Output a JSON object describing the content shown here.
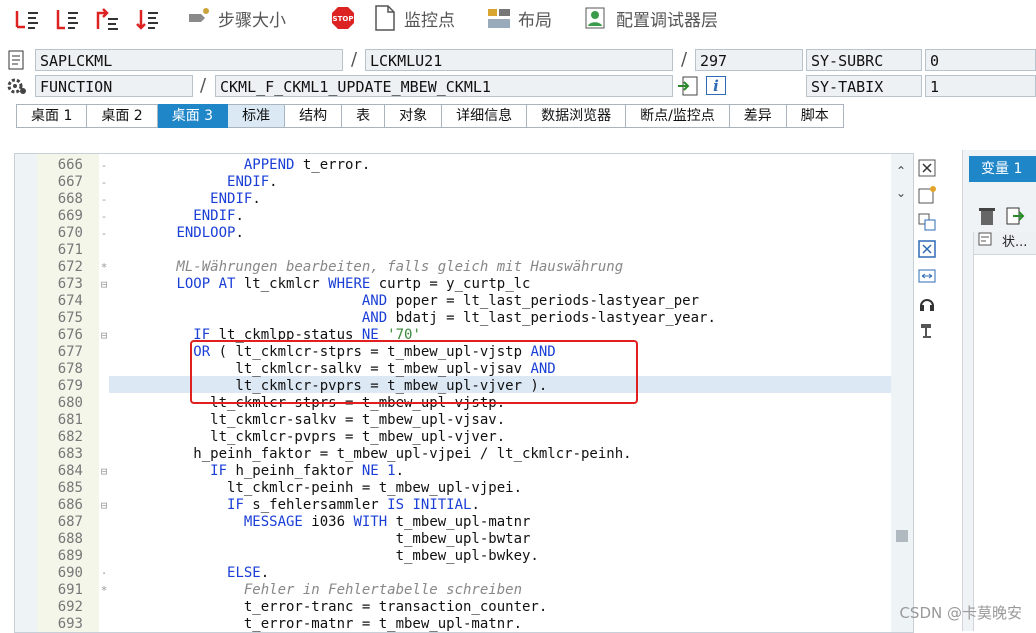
{
  "toolbar": {
    "step_label": "步骤大小",
    "watchpoint_label": "监控点",
    "layout_label": "布局",
    "config_label": "配置调试器层",
    "stop_text": "STOP"
  },
  "header": {
    "program": "SAPLCKML",
    "include": "LCKMLU21",
    "line": "297",
    "sy_subrc_label": "SY-SUBRC",
    "sy_subrc_value": "0",
    "type": "FUNCTION",
    "function_name": "CKML_F_CKML1_UPDATE_MBEW_CKML1",
    "sy_tabix_label": "SY-TABIX",
    "sy_tabix_value": "1",
    "info_text": "i",
    "slash": "/"
  },
  "tabs": [
    "桌面 1",
    "桌面 2",
    "桌面 3",
    "标准",
    "结构",
    "表",
    "对象",
    "详细信息",
    "数据浏览器",
    "断点/监控点",
    "差异",
    "脚本"
  ],
  "active_tab": 2,
  "right_panel": {
    "tab_label": "变量 1",
    "col_header": "状..."
  },
  "code_lines": [
    {
      "n": "666",
      "fold": "-",
      "html": "                APPEND t_error."
    },
    {
      "n": "667",
      "fold": "-",
      "html": "              ENDIF."
    },
    {
      "n": "668",
      "fold": "-",
      "html": "            ENDIF."
    },
    {
      "n": "669",
      "fold": "-",
      "html": "          ENDIF."
    },
    {
      "n": "670",
      "fold": "-",
      "html": "        ENDLOOP."
    },
    {
      "n": "671",
      "fold": "",
      "html": ""
    },
    {
      "n": "672",
      "fold": "*",
      "html": "        ML-Währungen bearbeiten, falls gleich mit Hauswährung"
    },
    {
      "n": "673",
      "fold": "⊟",
      "html": "        LOOP AT lt_ckmlcr WHERE curtp = y_curtp_lc"
    },
    {
      "n": "674",
      "fold": "",
      "html": "                              AND poper = lt_last_periods-lastyear_per"
    },
    {
      "n": "675",
      "fold": "",
      "html": "                              AND bdatj = lt_last_periods-lastyear_year."
    },
    {
      "n": "676",
      "fold": "⊟",
      "html": "          IF lt_ckmlpp-status NE '70'"
    },
    {
      "n": "677",
      "fold": "",
      "html": "          OR ( lt_ckmlcr-stprs = t_mbew_upl-vjstp AND"
    },
    {
      "n": "678",
      "fold": "",
      "html": "               lt_ckmlcr-salkv = t_mbew_upl-vjsav AND"
    },
    {
      "n": "679",
      "fold": "",
      "html": "               lt_ckmlcr-pvprs = t_mbew_upl-vjver )."
    },
    {
      "n": "680",
      "fold": "",
      "html": "            lt_ckmlcr-stprs = t_mbew_upl-vjstp."
    },
    {
      "n": "681",
      "fold": "",
      "html": "            lt_ckmlcr-salkv = t_mbew_upl-vjsav."
    },
    {
      "n": "682",
      "fold": "",
      "html": "            lt_ckmlcr-pvprs = t_mbew_upl-vjver."
    },
    {
      "n": "683",
      "fold": "",
      "html": "          h_peinh_faktor = t_mbew_upl-vjpei / lt_ckmlcr-peinh."
    },
    {
      "n": "684",
      "fold": "⊟",
      "html": "            IF h_peinh_faktor NE 1."
    },
    {
      "n": "685",
      "fold": "",
      "html": "              lt_ckmlcr-peinh = t_mbew_upl-vjpei."
    },
    {
      "n": "686",
      "fold": "⊟",
      "html": "              IF s_fehlersammler IS INITIAL."
    },
    {
      "n": "687",
      "fold": "",
      "html": "                MESSAGE i036 WITH t_mbew_upl-matnr"
    },
    {
      "n": "688",
      "fold": "",
      "html": "                                  t_mbew_upl-bwtar"
    },
    {
      "n": "689",
      "fold": "",
      "html": "                                  t_mbew_upl-bwkey."
    },
    {
      "n": "690",
      "fold": "·",
      "html": "              ELSE."
    },
    {
      "n": "691",
      "fold": "*",
      "html": "                Fehler in Fehlertabelle schreiben"
    },
    {
      "n": "692",
      "fold": "",
      "html": "                t_error-tranc = transaction_counter."
    },
    {
      "n": "693",
      "fold": "",
      "html": "                t_error-matnr = t_mbew_upl-matnr."
    }
  ],
  "watermark": "CSDN @卡莫晚安"
}
